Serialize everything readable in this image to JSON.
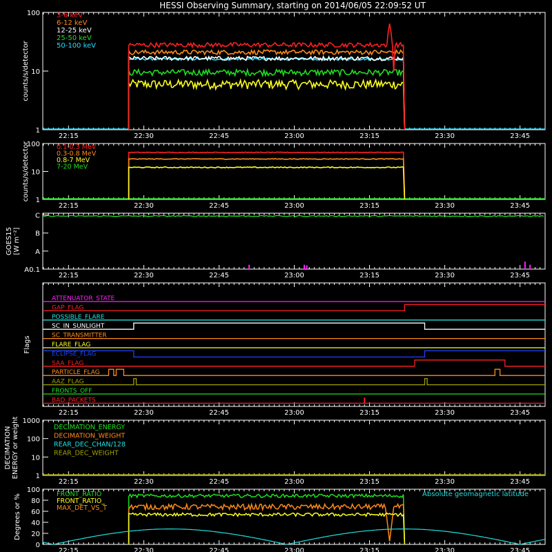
{
  "title": "HESSI Observing Summary, starting on 2014/06/05 22:09:52 UT",
  "time_axis": {
    "start": "22:09:52",
    "end": "23:50:00",
    "ticks": [
      "22:15",
      "22:30",
      "22:45",
      "23:00",
      "23:15",
      "23:30",
      "23:45"
    ]
  },
  "chart_data": [
    {
      "id": "count-rates",
      "type": "line",
      "ylabel": "counts/s/detector",
      "yscale": "log",
      "ylim": [
        1,
        100
      ],
      "yticks": [
        "1",
        "10",
        "100"
      ],
      "data_start": "22:27",
      "data_end": "23:22",
      "legend_placement": "top-left",
      "series": [
        {
          "name": "3-6 keV",
          "color": "#ff2020",
          "level": 28,
          "spread": 0.09
        },
        {
          "name": "6-12 keV",
          "color": "#ff8c1a",
          "level": 21,
          "spread": 0.09
        },
        {
          "name": "12-25 keV",
          "color": "#ffffff",
          "level": 16.5,
          "spread": 0.08
        },
        {
          "name": "25-50 keV",
          "color": "#20e020",
          "level": 9.5,
          "spread": 0.12
        },
        {
          "name": "50-100 keV",
          "color": "#20e0ff",
          "level": 16,
          "spread": 0.04
        }
      ],
      "extra_series": [
        {
          "color": "#ffff20",
          "level": 6,
          "spread": 0.18
        }
      ],
      "events": [
        {
          "time": "23:19",
          "series": 0,
          "peak": 65
        }
      ]
    },
    {
      "id": "high-energy",
      "type": "line",
      "ylabel": "counts/s/detector",
      "yscale": "log",
      "ylim": [
        1,
        100
      ],
      "yticks": [
        "1",
        "10",
        "100"
      ],
      "data_start": "22:27",
      "data_end": "23:22",
      "legend_placement": "top-left",
      "series": [
        {
          "name": "0.1-0.3 MeV",
          "color": "#ff2020",
          "level": 48,
          "spread": 0.03
        },
        {
          "name": "0.3-0.8 MeV",
          "color": "#ff8c1a",
          "level": 28,
          "spread": 0.03
        },
        {
          "name": "0.8-7 MeV",
          "color": "#ffff20",
          "level": 14,
          "spread": 0.04
        },
        {
          "name": "7-20 MeV",
          "color": "#20e020",
          "level": 1,
          "spread": 0
        }
      ]
    },
    {
      "id": "goes",
      "type": "line",
      "ylabel": "GOES15",
      "yunits": "[W m⁻²]",
      "ylim": [
        0,
        4
      ],
      "yticks": [
        "A0.1",
        "A",
        "B",
        "C"
      ],
      "series": [
        {
          "color": "#20e020",
          "level": 3.6
        }
      ],
      "spikes": [
        {
          "time": "22:51",
          "height": 0.35
        },
        {
          "time": "23:02",
          "height": 0.35
        },
        {
          "time": "23:02.5",
          "height": 0.3
        },
        {
          "time": "23:46",
          "height": 0.6
        },
        {
          "time": "23:47",
          "height": 0.35
        }
      ],
      "spike_color": "#ff20ff"
    },
    {
      "id": "flags",
      "type": "line",
      "ylabel": "Flags",
      "series": [
        {
          "name": "ATTENUATOR_STATE",
          "color": "#ff20ff",
          "segments": [
            [
              "start",
              "end",
              0
            ]
          ]
        },
        {
          "name": "GAP_FLAG",
          "color": "#ff2020",
          "segments": [
            [
              "start",
              "23:22",
              0
            ],
            [
              "23:22",
              "end",
              1
            ]
          ]
        },
        {
          "name": "POSSIBLE_FLARE",
          "color": "#20e0e0",
          "segments": [
            [
              "start",
              "end",
              0
            ]
          ]
        },
        {
          "name": "SC_IN_SUNLIGHT",
          "color": "#ffffff",
          "segments": [
            [
              "start",
              "22:28",
              0
            ],
            [
              "22:28",
              "23:26",
              1
            ],
            [
              "23:26",
              "end",
              0
            ]
          ]
        },
        {
          "name": "SC_TRANSMITTER",
          "color": "#ff8c1a",
          "segments": [
            [
              "start",
              "end",
              0
            ]
          ]
        },
        {
          "name": "FLARE_FLAG",
          "color": "#ffff20",
          "segments": [
            [
              "start",
              "end",
              0
            ]
          ]
        },
        {
          "name": "ECLIPSE_FLAG",
          "color": "#2040ff",
          "segments": [
            [
              "start",
              "22:28",
              1
            ],
            [
              "22:28",
              "23:26",
              0
            ],
            [
              "23:26",
              "end",
              1
            ]
          ]
        },
        {
          "name": "SAA_FLAG",
          "color": "#ff2020",
          "segments": [
            [
              "start",
              "23:24",
              0
            ],
            [
              "23:24",
              "23:42",
              1
            ],
            [
              "23:42",
              "end",
              0
            ]
          ]
        },
        {
          "name": "PARTICLE_FLAG",
          "color": "#ff8c1a",
          "segments": [
            [
              "start",
              "22:23",
              0
            ],
            [
              "22:23",
              "22:24",
              1
            ],
            [
              "22:24",
              "22:24.5",
              0
            ],
            [
              "22:24.5",
              "22:26",
              1
            ],
            [
              "22:26",
              "23:40",
              0
            ],
            [
              "23:40",
              "23:41",
              1
            ],
            [
              "23:41",
              "end",
              0
            ]
          ]
        },
        {
          "name": "AAZ_FLAG",
          "color": "#a0a000",
          "segments": [
            [
              "start",
              "22:28",
              0
            ],
            [
              "22:28",
              "22:28.5",
              1
            ],
            [
              "22:28.5",
              "23:26",
              0
            ],
            [
              "23:26",
              "23:26.5",
              1
            ],
            [
              "23:26.5",
              "end",
              0
            ]
          ]
        },
        {
          "name": "FRONTS_OFF",
          "color": "#20e020",
          "segments": [
            [
              "start",
              "end",
              0
            ]
          ]
        },
        {
          "name": "BAD_PACKETS",
          "color": "#ff2020",
          "segments": [
            [
              "start",
              "end",
              0
            ]
          ]
        }
      ],
      "spikes": [
        {
          "series": 11,
          "time": "23:14"
        }
      ]
    },
    {
      "id": "decimation",
      "type": "line",
      "ylabel": "DECIMATION",
      "ylabel2": "ENERGY or weight",
      "yscale": "log",
      "ylim": [
        1,
        1000
      ],
      "yticks": [
        "1",
        "10",
        "100",
        "1000"
      ],
      "series": [
        {
          "name": "DECIMATION_ENERGY",
          "color": "#20e020"
        },
        {
          "name": "DECIMATION_WEIGHT",
          "color": "#ff8c1a"
        },
        {
          "name": "REAR_DEC_CHAN/128",
          "color": "#20e0e0"
        },
        {
          "name": "REAR_DEC_WEIGHT",
          "color": "#a0a000"
        }
      ]
    },
    {
      "id": "ratios",
      "type": "line",
      "ylabel": "Degrees or %",
      "ylim": [
        0,
        100
      ],
      "yticks": [
        "0",
        "20",
        "40",
        "60",
        "80",
        "100"
      ],
      "data_start": "22:27",
      "data_end": "23:22",
      "series": [
        {
          "name": "FRONT_RATIO",
          "color": "#20e020",
          "level": 88,
          "spread": 3
        },
        {
          "name": "FRONT_RATIO_",
          "color": "#ffff20",
          "level": 54,
          "spread": 3
        },
        {
          "name": "MAX_DET_VS_T",
          "color": "#ff8c1a",
          "level": 68,
          "spread": 5
        }
      ],
      "dip": {
        "time": "23:19",
        "series": 2,
        "low": 5
      },
      "annotation": {
        "text": "Absolute geomagnetic latitude",
        "color": "#20e0e0"
      },
      "latitude_curve": {
        "color": "#20e0e0",
        "period_minutes": 93,
        "min_time": "22:12",
        "amplitude": 28
      }
    }
  ]
}
